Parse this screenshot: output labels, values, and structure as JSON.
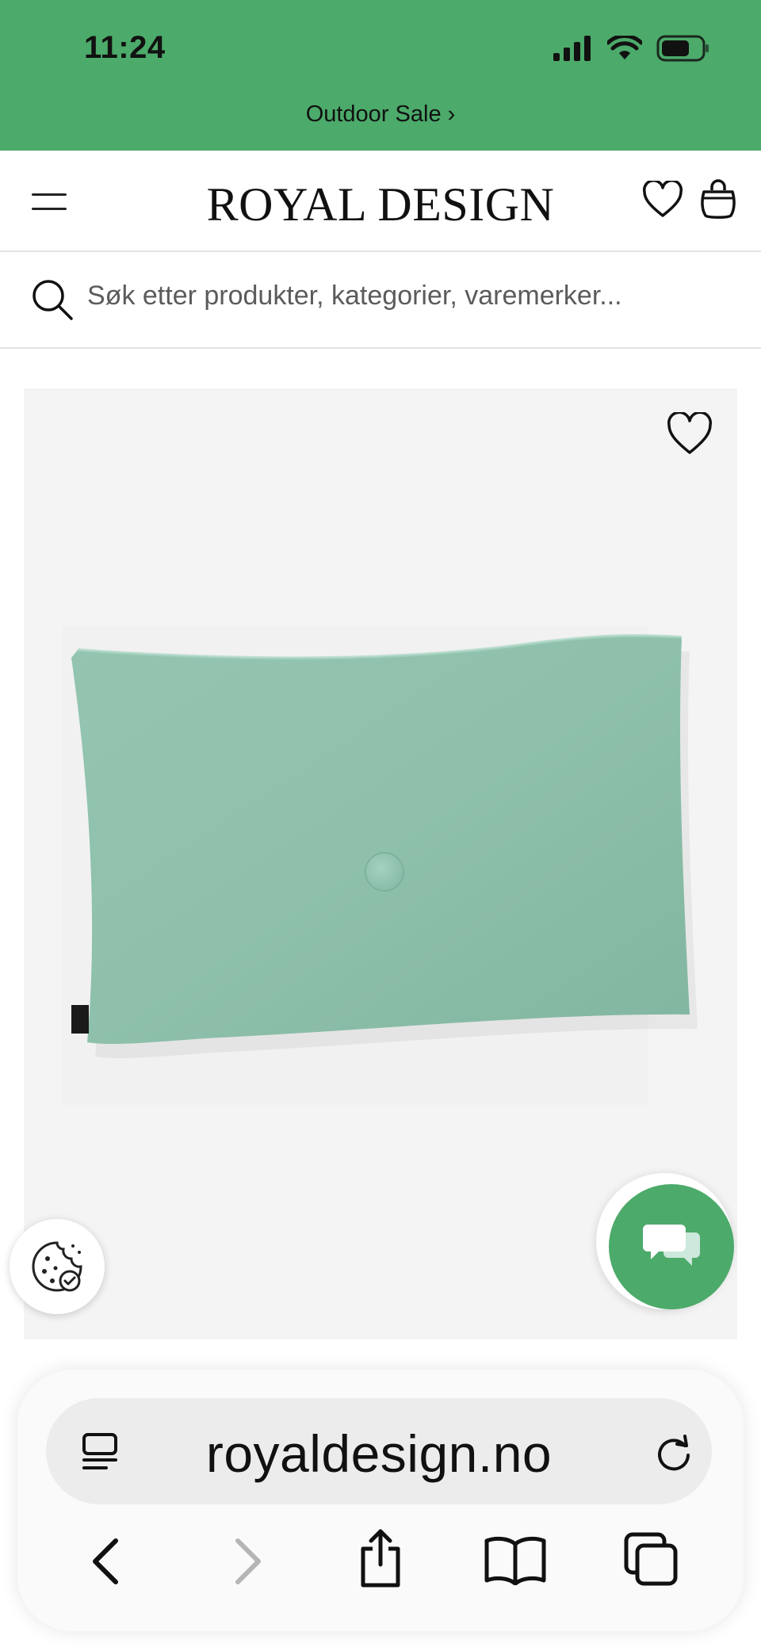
{
  "status_bar": {
    "time": "11:24"
  },
  "promo": {
    "text": "Outdoor Sale ›"
  },
  "header": {
    "brand": "ROYAL DESIGN"
  },
  "search": {
    "placeholder": "Søk etter produkter, kategorier, varemerker..."
  },
  "browser": {
    "url": "royaldesign.no"
  },
  "colors": {
    "brand_green": "#4caa6a",
    "pillow_green": "#8fc2ad",
    "image_bg": "#f4f4f4"
  },
  "icons": [
    "menu-icon",
    "heart-icon",
    "bag-icon",
    "search-icon",
    "cookie-icon",
    "chat-icon",
    "reader-icon",
    "reload-icon",
    "back-icon",
    "forward-icon",
    "share-icon",
    "bookmarks-icon",
    "tabs-icon"
  ]
}
